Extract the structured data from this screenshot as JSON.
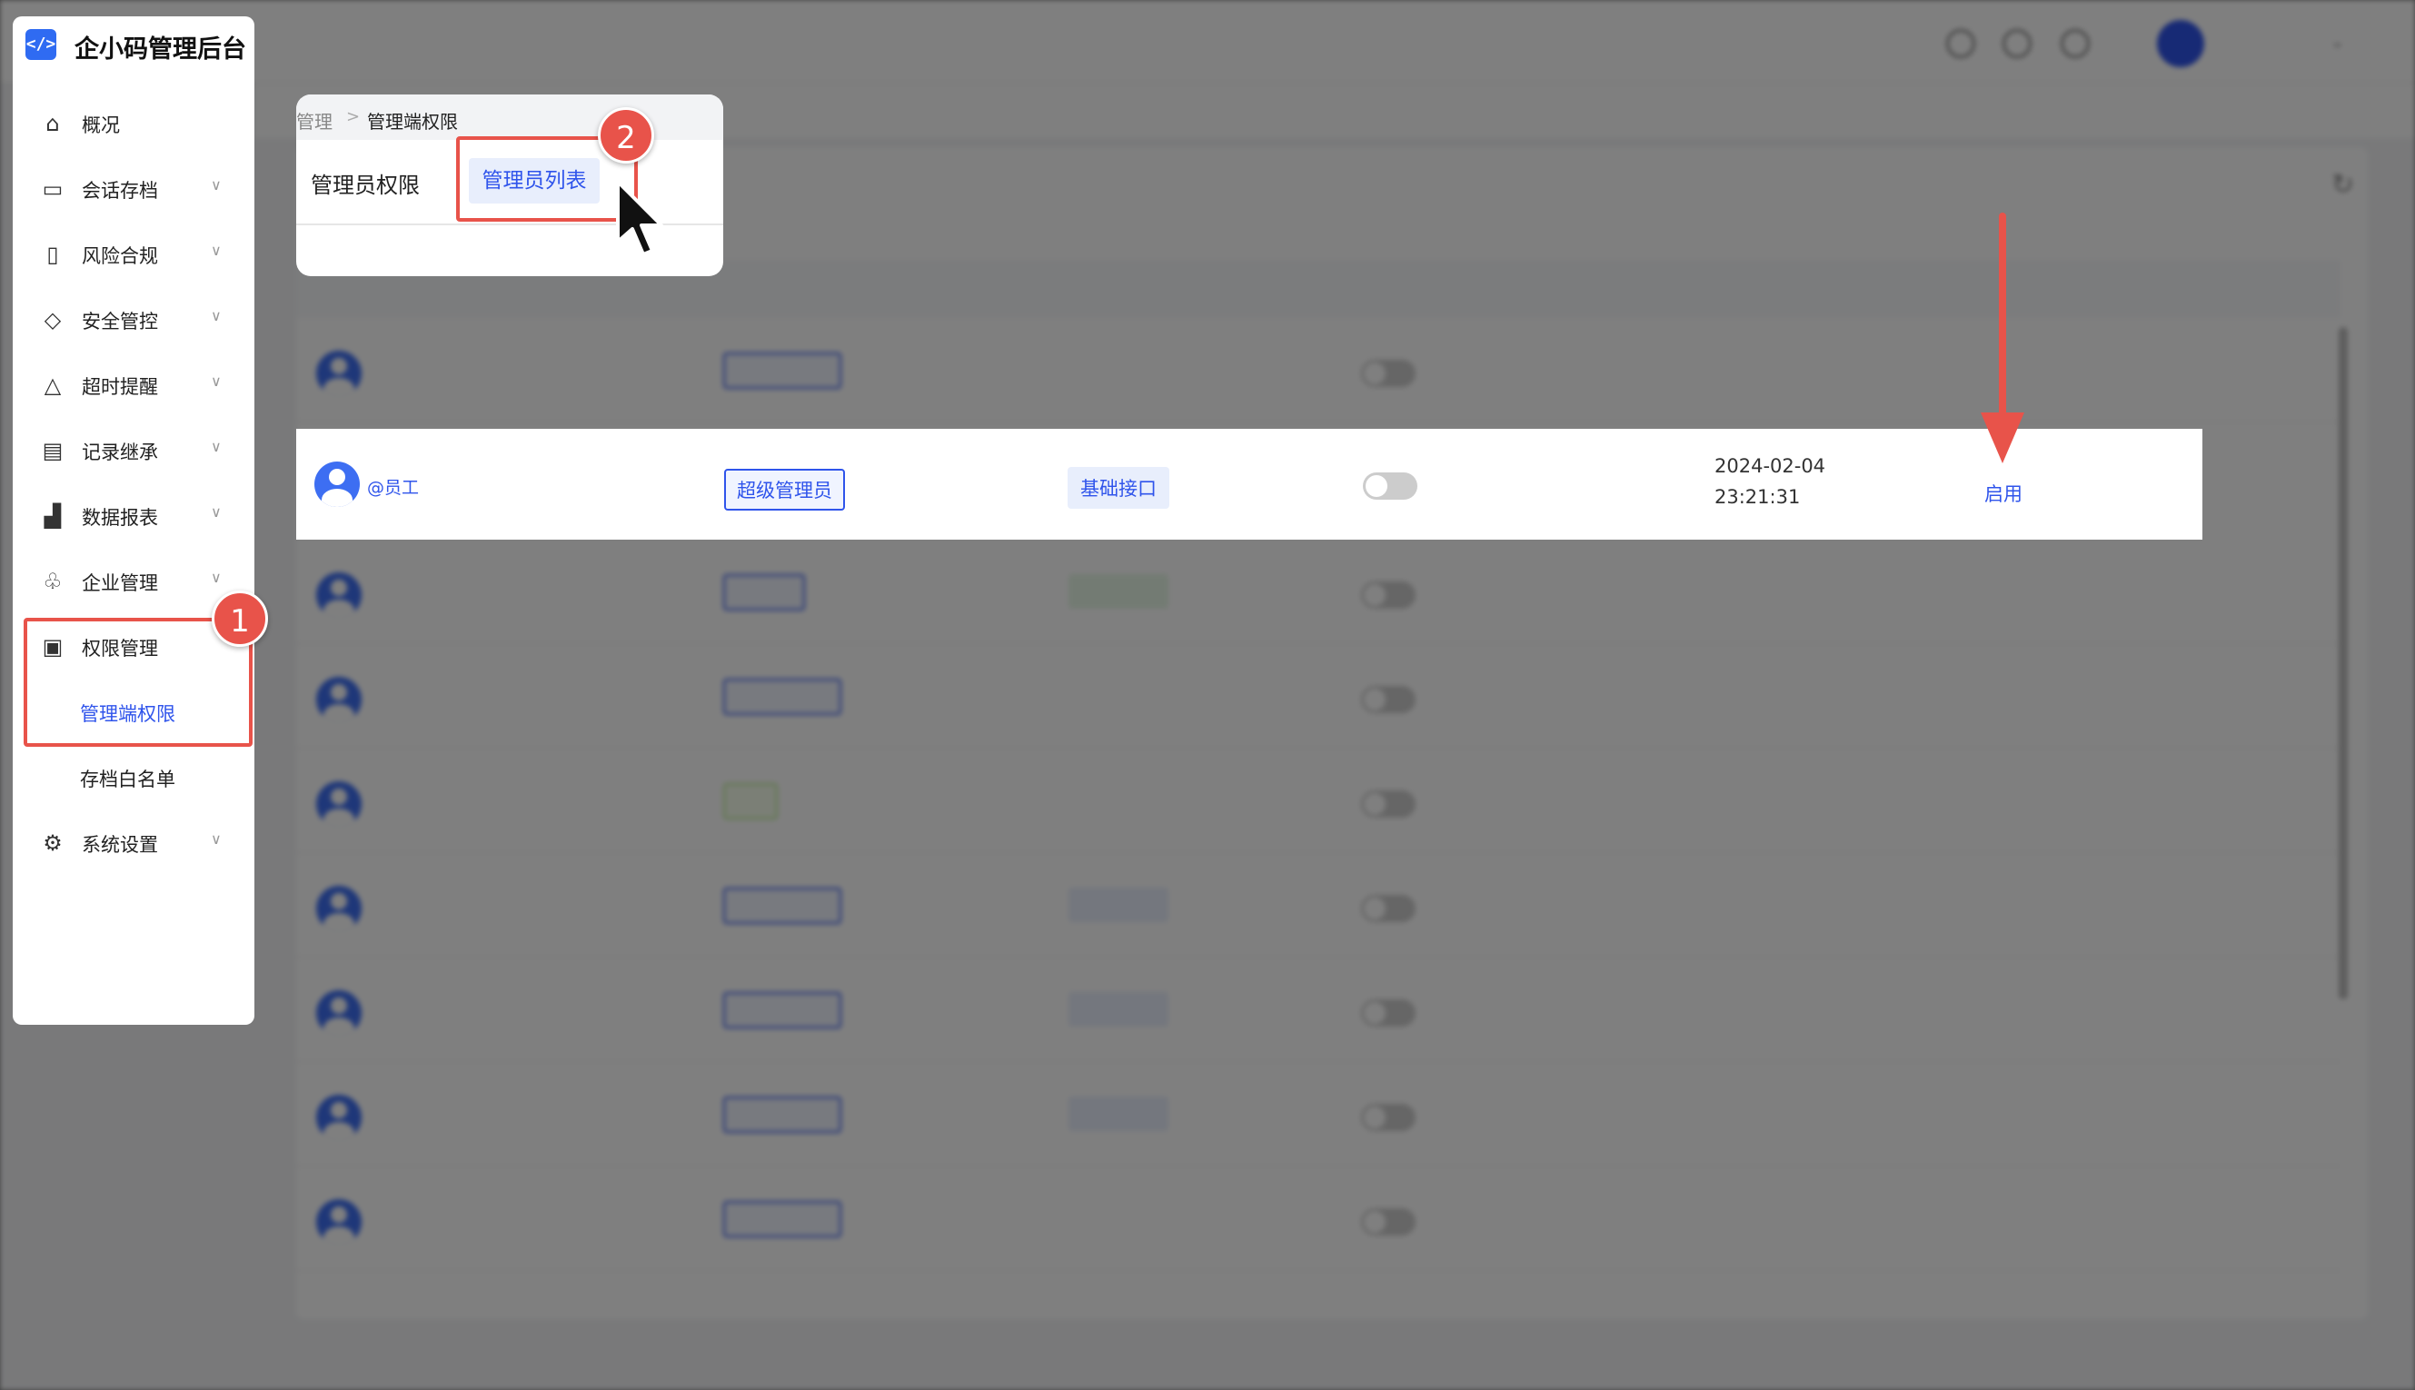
{
  "sidebar": {
    "app_title": "企小码管理后台",
    "logo_glyph": "</>",
    "items": [
      {
        "label": "概况",
        "icon": "building-icon"
      },
      {
        "label": "会话存档",
        "icon": "folder-icon"
      },
      {
        "label": "风险合规",
        "icon": "alert-box-icon"
      },
      {
        "label": "安全管控",
        "icon": "shield-icon"
      },
      {
        "label": "超时提醒",
        "icon": "bell-icon"
      },
      {
        "label": "记录继承",
        "icon": "document-transfer-icon"
      },
      {
        "label": "数据报表",
        "icon": "chart-icon"
      },
      {
        "label": "企业管理",
        "icon": "org-icon"
      },
      {
        "label": "权限管理",
        "icon": "permission-icon"
      },
      {
        "label": "系统设置",
        "icon": "settings-icon"
      }
    ],
    "sub_items": {
      "admin_permissions": "管理端权限",
      "archive_whitelist": "存档白名单"
    }
  },
  "breadcrumb": {
    "prev": "管理",
    "separator": ">",
    "current": "管理端权限"
  },
  "tabs": {
    "tab1": "管理员权限",
    "tab2": "管理员列表"
  },
  "badges": {
    "step1": "1",
    "step2": "2"
  },
  "highlight_row": {
    "name": "@员工",
    "role": "超级管理员",
    "interface": "基础接口",
    "time_date": "2024-02-04",
    "time_clock": "23:21:31",
    "action": "启用"
  },
  "colors": {
    "accent": "#2f54eb",
    "annotation_red": "#e8534a",
    "orange_action": "#fa8c16"
  }
}
